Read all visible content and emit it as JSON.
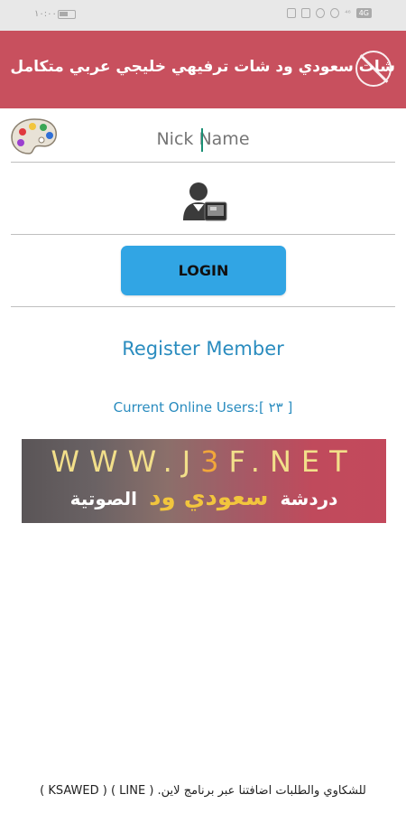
{
  "status_bar": {
    "time": "١٠:٠٠",
    "network_badge": "4G",
    "signal": "⁴⁶"
  },
  "header": {
    "title": "شات سعودي ود شات ترفيهي خليجي عربي متكامل"
  },
  "form": {
    "nick_placeholder": "Nick Name",
    "login_label": "LOGIN"
  },
  "register_label": "Register Member",
  "online_users": "Current Online Users:[ ٢٣ ]",
  "banner": {
    "url_prefix": "WWW.J",
    "url_highlight": "3",
    "url_suffix": "F.NET",
    "left_text": "دردشة",
    "mid_text": "سعودي ود",
    "right_text": "الصوتية"
  },
  "footer": "للشكاوي والطلبات اضافتنا عبر برنامج لاين. ( LINE ) ( KSAWED )",
  "colors": {
    "header": "#c8505e",
    "login": "#31a5e4",
    "link": "#2a8cbf"
  },
  "icons": {
    "palette": "palette-icon",
    "avatar": "user-avatar-icon",
    "logout": "logout-icon"
  }
}
